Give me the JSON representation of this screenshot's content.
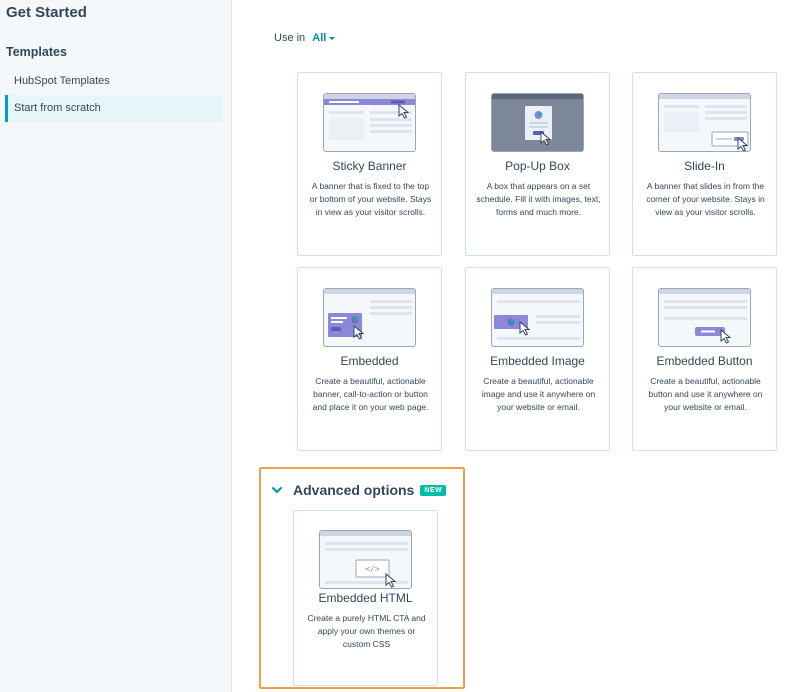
{
  "sidebar": {
    "title": "Get Started",
    "section": "Templates",
    "items": [
      {
        "label": "HubSpot Templates"
      },
      {
        "label": "Start from scratch"
      }
    ]
  },
  "filter": {
    "label": "Use in",
    "value": "All"
  },
  "cards": [
    {
      "name": "Sticky Banner",
      "desc": "A banner that is fixed to the top or bottom of your website. Stays in view as your visitor scrolls."
    },
    {
      "name": "Pop-Up Box",
      "desc": "A box that appears on a set schedule. Fill it with images, text, forms and much more."
    },
    {
      "name": "Slide-In",
      "desc": "A banner that slides in from the corner of your website. Stays in view as your visitor scrolls."
    },
    {
      "name": "Embedded",
      "desc": "Create a beautiful, actionable banner, call-to-action or button and place it on your web page."
    },
    {
      "name": "Embedded Image",
      "desc": "Create a beautiful, actionable image and use it anywhere on your website or email."
    },
    {
      "name": "Embedded Button",
      "desc": "Create a beautiful, actionable button and use it anywhere on your website or email."
    }
  ],
  "advanced": {
    "title": "Advanced options",
    "badge": "NEW",
    "card": {
      "name": "Embedded HTML",
      "desc": "Create a purely HTML CTA and apply your own themes or custom CSS",
      "code_glyph": "</>"
    }
  },
  "colors": {
    "accent": "#00a4bd",
    "link": "#0091ae",
    "highlight_border": "#f0a04b",
    "badge": "#00bda5",
    "thumb_accent": "#8b88d8"
  }
}
